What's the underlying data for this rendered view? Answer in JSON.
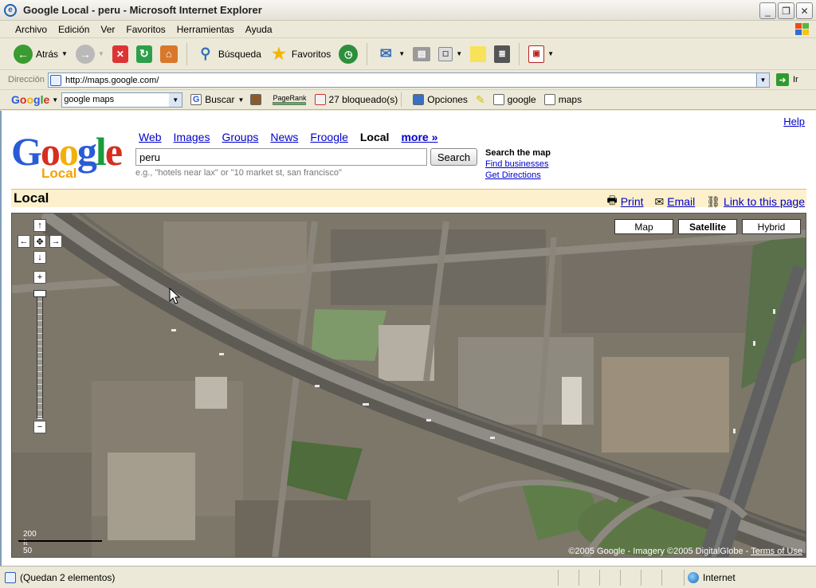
{
  "window": {
    "title": "Google Local - peru - Microsoft Internet Explorer"
  },
  "menu": [
    "Archivo",
    "Edición",
    "Ver",
    "Favoritos",
    "Herramientas",
    "Ayuda"
  ],
  "toolbar": {
    "back": "Atrás",
    "search": "Búsqueda",
    "favorites": "Favoritos"
  },
  "address": {
    "label": "Dirección",
    "url": "http://maps.google.com/",
    "go": "Ir"
  },
  "googlebar": {
    "logo": "Google",
    "query": "google maps",
    "search": "Buscar",
    "pagerank": "PageRank",
    "blocked": "27 bloqueado(s)",
    "options": "Opciones",
    "hl1": "google",
    "hl2": "maps"
  },
  "page": {
    "help": "Help",
    "logo_word": "Google",
    "logo_sub": "Local",
    "nav": [
      "Web",
      "Images",
      "Groups",
      "News",
      "Froogle",
      "Local",
      "more »"
    ],
    "search_value": "peru",
    "search_button": "Search",
    "hint": "e.g., \"hotels near lax\" or \"10 market st, san francisco\"",
    "search_map_title": "Search the map",
    "find_businesses": "Find businesses",
    "get_directions": "Get Directions",
    "section_title": "Local",
    "print": "Print",
    "email": "Email",
    "link": "Link to this page"
  },
  "map": {
    "types": [
      "Map",
      "Satellite",
      "Hybrid"
    ],
    "selected_type": "Satellite",
    "scale_ft": "200 ft",
    "scale_m": "50 m",
    "copyright": "©2005 Google - Imagery ©2005 DigitalGlobe - ",
    "terms": "Terms of Use"
  },
  "status": {
    "text": "(Quedan 2 elementos)",
    "zone": "Internet"
  }
}
